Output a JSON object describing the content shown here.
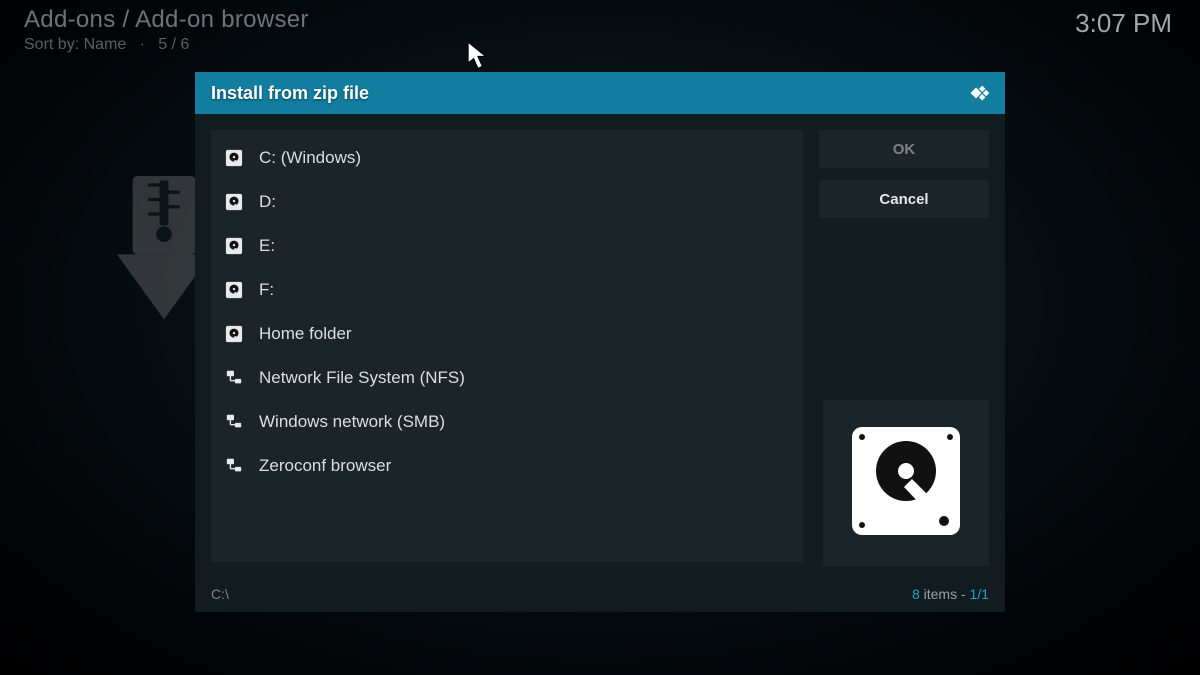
{
  "background": {
    "title": "Add-ons / Add-on browser",
    "sort_label": "Sort by: Name",
    "sort_index": "5 / 6",
    "clock": "3:07 PM"
  },
  "dialog": {
    "title": "Install from zip file",
    "items": [
      {
        "icon": "disk",
        "label": "C: (Windows)"
      },
      {
        "icon": "disk",
        "label": "D:"
      },
      {
        "icon": "disk",
        "label": "E:"
      },
      {
        "icon": "disk",
        "label": "F:"
      },
      {
        "icon": "disk",
        "label": "Home folder"
      },
      {
        "icon": "network",
        "label": "Network File System (NFS)"
      },
      {
        "icon": "network",
        "label": "Windows network (SMB)"
      },
      {
        "icon": "network",
        "label": "Zeroconf browser"
      }
    ],
    "buttons": {
      "ok": "OK",
      "cancel": "Cancel"
    },
    "footer": {
      "path": "C:\\",
      "count": "8",
      "items_word": " items - ",
      "page": "1/1"
    }
  }
}
